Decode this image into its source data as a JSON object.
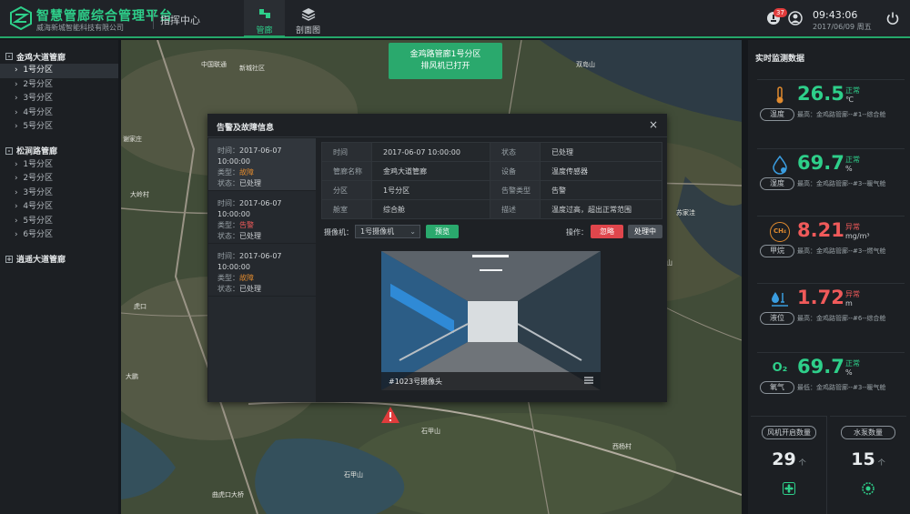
{
  "header": {
    "brand_title": "智慧管廊综合管理平台",
    "brand_sub": "威海新城智能科技有限公司",
    "center_label": "指挥中心",
    "tabs": [
      {
        "label": "管廊"
      },
      {
        "label": "剖面图"
      }
    ],
    "notification_count": "37",
    "time": "09:43:06",
    "date": "2017/06/09 周五"
  },
  "sidebar": {
    "groups": [
      {
        "title": "金鸡大道管廊",
        "toggle": "-",
        "items": [
          "1号分区",
          "2号分区",
          "3号分区",
          "4号分区",
          "5号分区"
        ]
      },
      {
        "title": "松涧路管廊",
        "toggle": "-",
        "items": [
          "1号分区",
          "2号分区",
          "3号分区",
          "4号分区",
          "5号分区",
          "6号分区"
        ]
      },
      {
        "title": "逍遥大道管廊",
        "toggle": "+",
        "items": []
      }
    ]
  },
  "notification": {
    "line1": "金鸡路管廊1号分区",
    "line2": "排风机已打开"
  },
  "dialog": {
    "title": "告警及故障信息",
    "close": "×",
    "alarms": [
      {
        "time_k": "时间：",
        "time": "2017-06-07 10:00:00",
        "type_k": "类型：",
        "type": "故障",
        "status_k": "状态：",
        "status": "已处理"
      },
      {
        "time_k": "时间：",
        "time": "2017-06-07 10:00:00",
        "type_k": "类型：",
        "type": "告警",
        "status_k": "状态：",
        "status": "已处理"
      },
      {
        "time_k": "时间：",
        "time": "2017-06-07 10:00:00",
        "type_k": "类型：",
        "type": "故障",
        "status_k": "状态：",
        "status": "已处理"
      }
    ],
    "info": [
      [
        "时间",
        "2017-06-07 10:00:00",
        "状态",
        "已处理"
      ],
      [
        "管廊名称",
        "金鸡大道管廊",
        "设备",
        "温度传感器"
      ],
      [
        "分区",
        "1号分区",
        "告警类型",
        "告警"
      ],
      [
        "舱室",
        "综合舱",
        "描述",
        "温度过高，超出正常范围"
      ]
    ],
    "camera_label": "摄像机：",
    "camera_value": "1号摄像机",
    "preview_btn": "预览",
    "operation_label": "操作：",
    "ignore_btn": "忽略",
    "processing_btn": "处理中",
    "video_caption": "#1023号摄像头"
  },
  "right_panel": {
    "title": "实时监测数据",
    "metrics": [
      {
        "label": "温度",
        "value": "26.5",
        "status": "正常",
        "unit": "℃",
        "note": "最高：金鸡路管廊--#1--综合舱",
        "color": "#2ecf8a",
        "icon": "thermometer-icon"
      },
      {
        "label": "湿度",
        "value": "69.7",
        "status": "正常",
        "unit": "%",
        "note": "最高：金鸡路管廊--#3--暖气舱",
        "color": "#2ecf8a",
        "icon": "humidity-icon"
      },
      {
        "label": "甲烷",
        "value": "8.21",
        "status": "异常",
        "unit": "mg/m³",
        "note": "最高：金鸡路管廊--#3--燃气舱",
        "color": "#f05a5a",
        "icon": "methane-icon",
        "icon_text": "CH₄"
      },
      {
        "label": "液位",
        "value": "1.72",
        "status": "异常",
        "unit": "m",
        "note": "最高：金鸡路管廊--#6--综合舱",
        "color": "#f05a5a",
        "icon": "water-level-icon"
      },
      {
        "label": "氧气",
        "value": "69.7",
        "status": "正常",
        "unit": "%",
        "note": "最低：金鸡路管廊--#3--暖气舱",
        "color": "#2ecf8a",
        "icon": "oxygen-icon",
        "icon_text": "O₂"
      }
    ],
    "fan": {
      "label": "风机开启数量",
      "value": "29",
      "unit": "个"
    },
    "pump": {
      "label": "水泵数量",
      "value": "15",
      "unit": "个"
    }
  },
  "map_labels": [
    "中国联通",
    "新城社区",
    "虎口",
    "石甲山",
    "西杨村",
    "大岭村",
    "曲虎口大桥",
    "谢家庄",
    "苏家洼",
    "双岛山",
    "凤凰山",
    "大鹏",
    "石甲山"
  ],
  "colors": {
    "accent": "#25a86b",
    "normal": "#2ecf8a",
    "abnormal": "#f05a5a",
    "warning": "#e08a2e"
  }
}
